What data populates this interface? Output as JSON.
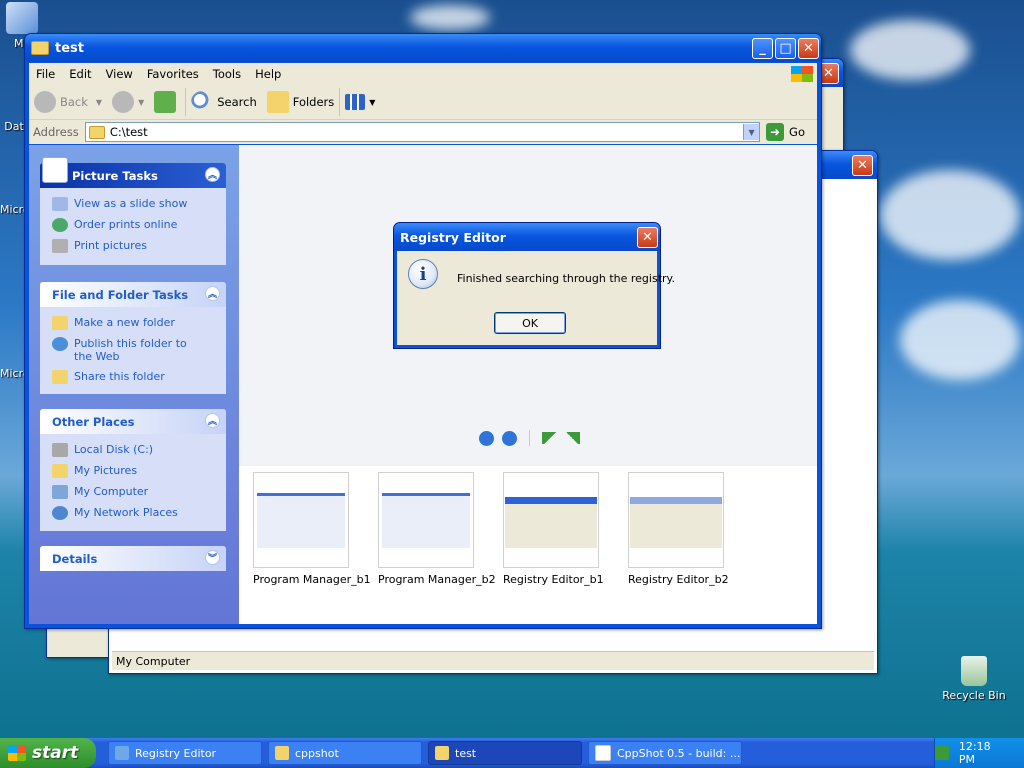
{
  "desktop": {
    "icons": [
      {
        "label": "My"
      },
      {
        "label": "Dat"
      },
      {
        "label": "Micro"
      },
      {
        "label": "Micro"
      },
      {
        "label": "Recycle Bin"
      }
    ]
  },
  "bg_window": {
    "status": "My Computer"
  },
  "window": {
    "title": "test",
    "menu": [
      "File",
      "Edit",
      "View",
      "Favorites",
      "Tools",
      "Help"
    ],
    "toolbar": {
      "back": "Back",
      "search": "Search",
      "folders": "Folders"
    },
    "address": {
      "label": "Address",
      "value": "C:\\test",
      "go": "Go"
    },
    "panels": {
      "picture_tasks": {
        "title": "Picture Tasks",
        "items": [
          "View as a slide show",
          "Order prints online",
          "Print pictures"
        ]
      },
      "file_tasks": {
        "title": "File and Folder Tasks",
        "items": [
          "Make a new folder",
          "Publish this folder to the Web",
          "Share this folder"
        ]
      },
      "other_places": {
        "title": "Other Places",
        "items": [
          "Local Disk (C:)",
          "My Pictures",
          "My Computer",
          "My Network Places"
        ]
      },
      "details": {
        "title": "Details"
      }
    },
    "thumbnails": [
      {
        "caption": "Program Manager_b1"
      },
      {
        "caption": "Program Manager_b2"
      },
      {
        "caption": "Registry Editor_b1"
      },
      {
        "caption": "Registry Editor_b2"
      }
    ]
  },
  "dialog": {
    "title": "Registry Editor",
    "message": "Finished searching through the registry.",
    "ok": "OK"
  },
  "taskbar": {
    "start": "start",
    "buttons": [
      {
        "label": "Registry Editor"
      },
      {
        "label": "cppshot"
      },
      {
        "label": "test"
      },
      {
        "label": "CppShot 0.5 - build: ..."
      }
    ],
    "clock": "12:18 PM"
  },
  "colors": {
    "title_blue": "#0a53d8",
    "link": "#215dc6",
    "dialog_bg": "#ece9d8",
    "start_green": "#3a9c35"
  }
}
